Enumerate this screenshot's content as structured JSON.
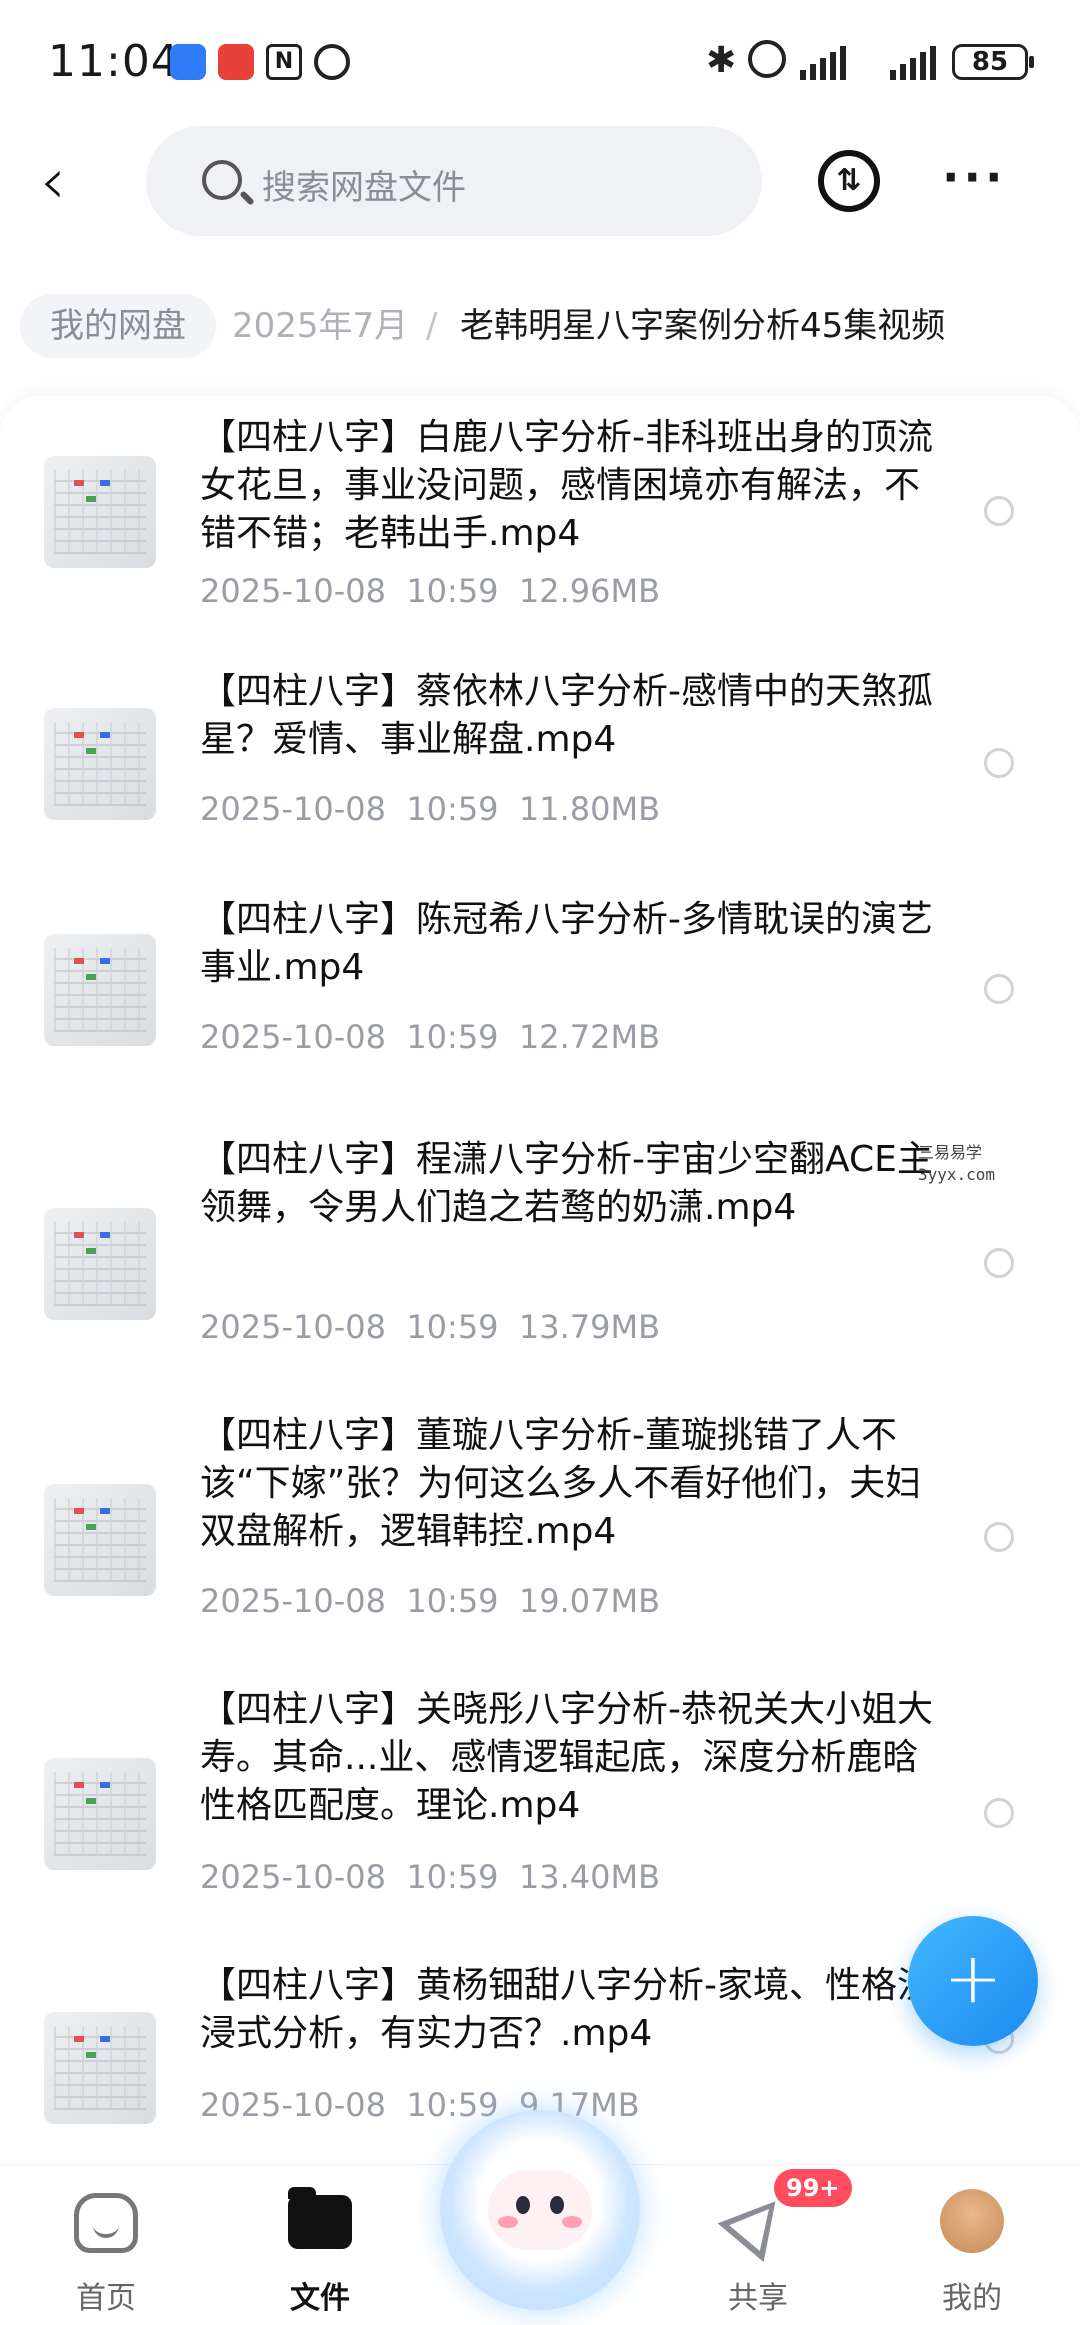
{
  "status_bar": {
    "time": "11:04",
    "battery": "85",
    "hotspot_sup": "1"
  },
  "header": {
    "search_placeholder": "搜索网盘文件",
    "back_icon": "chevron-left-icon",
    "transfer_icon": "transfer-icon",
    "more_icon": "more-horizontal-icon"
  },
  "breadcrumb": {
    "root": "我的网盘",
    "middle": "2025年7月",
    "separator": "/",
    "current": "老韩明星八字案例分析45集视频"
  },
  "files": [
    {
      "title": "【四柱八字】白鹿八字分析-非科班出身的顶流女花旦，事业没问题，感情困境亦有解法，不错不错；老韩出手.mp4",
      "date": "2025-10-08",
      "time": "10:59",
      "size": "12.96MB"
    },
    {
      "title": "【四柱八字】蔡依林八字分析-感情中的天煞孤星？爱情、事业解盘.mp4",
      "date": "2025-10-08",
      "time": "10:59",
      "size": "11.80MB"
    },
    {
      "title": "【四柱八字】陈冠希八字分析-多情耽误的演艺事业.mp4",
      "date": "2025-10-08",
      "time": "10:59",
      "size": "12.72MB"
    },
    {
      "title": "【四柱八字】程潇八字分析-宇宙少空翻ACE主领舞，令男人们趋之若鹜的奶潇.mp4",
      "date": "2025-10-08",
      "time": "10:59",
      "size": "13.79MB"
    },
    {
      "title": "【四柱八字】董璇八字分析-董璇挑错了人不该“下嫁”张？为何这么多人不看好他们，夫妇双盘解析，逻辑韩控.mp4",
      "date": "2025-10-08",
      "time": "10:59",
      "size": "19.07MB"
    },
    {
      "title": "【四柱八字】关晓彤八字分析-恭祝关大小姐大寿。其命...业、感情逻辑起底，深度分析鹿晗性格匹配度。理论.mp4",
      "date": "2025-10-08",
      "time": "10:59",
      "size": "13.40MB"
    },
    {
      "title": "【四柱八字】黄杨钿甜八字分析-家境、性格沉浸式分析，有实力否？.mp4",
      "date": "2025-10-08",
      "time": "10:59",
      "size": "9.17MB"
    }
  ],
  "watermark": {
    "line1": "三易易学",
    "line2": "3yyx.com"
  },
  "fab": {
    "label": "+"
  },
  "bottom_nav": {
    "home": "首页",
    "files": "文件",
    "share": "共享",
    "share_badge": "99+",
    "me": "我的"
  }
}
